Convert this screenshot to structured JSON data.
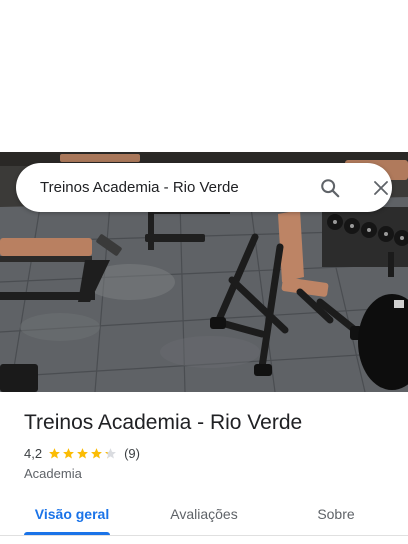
{
  "search": {
    "query": "Treinos Academia - Rio Verde",
    "search_icon": "search-icon",
    "close_icon": "close-icon"
  },
  "photo": {
    "subject": "gym floor with weight benches and dumbbell rack"
  },
  "place": {
    "name": "Treinos Academia - Rio Verde",
    "rating": "4,2",
    "stars": 4.2,
    "reviews_count": "(9)",
    "category": "Academia"
  },
  "tabs": [
    {
      "label": "Visão geral",
      "active": true
    },
    {
      "label": "Avaliações",
      "active": false
    },
    {
      "label": "Sobre",
      "active": false
    }
  ],
  "colors": {
    "accent": "#1a73e8",
    "star": "#fbbc04",
    "star_empty": "#dadce0",
    "text_primary": "#202124",
    "text_secondary": "#5f6368"
  }
}
